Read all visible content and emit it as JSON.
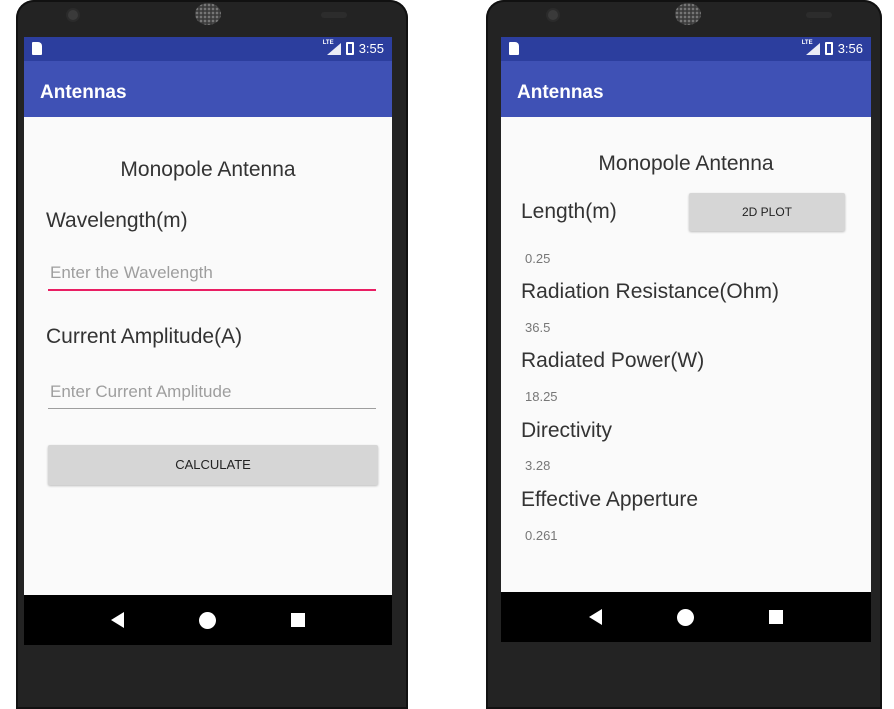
{
  "left_screen": {
    "status_time": "3:55",
    "signal_label": "LTE",
    "app_title": "Antennas",
    "heading": "Monopole Antenna",
    "wavelength_label": "Wavelength(m)",
    "wavelength_placeholder": "Enter the Wavelength",
    "current_label": "Current Amplitude(A)",
    "current_placeholder": "Enter Current Amplitude",
    "calculate_label": "CALCULATE"
  },
  "right_screen": {
    "status_time": "3:56",
    "signal_label": "LTE",
    "app_title": "Antennas",
    "heading": "Monopole Antenna",
    "length_label": "Length(m)",
    "plot_button_label": "2D PLOT",
    "length_value": "0.25",
    "radiation_resistance_label": "Radiation Resistance(Ohm)",
    "radiation_resistance_value": "36.5",
    "radiated_power_label": "Radiated Power(W)",
    "radiated_power_value": "18.25",
    "directivity_label": "Directivity",
    "directivity_value": "3.28",
    "effective_aperture_label": "Effective Apperture",
    "effective_aperture_value": "0.261"
  },
  "colors": {
    "status_bar": "#2c3e9e",
    "app_bar": "#3f51b5",
    "focus_underline": "#e91e63",
    "button": "#d6d6d6"
  },
  "icons": {
    "nav": [
      "back-icon",
      "home-icon",
      "recents-icon"
    ],
    "status": [
      "sim-card-icon",
      "signal-icon",
      "battery-icon"
    ]
  }
}
